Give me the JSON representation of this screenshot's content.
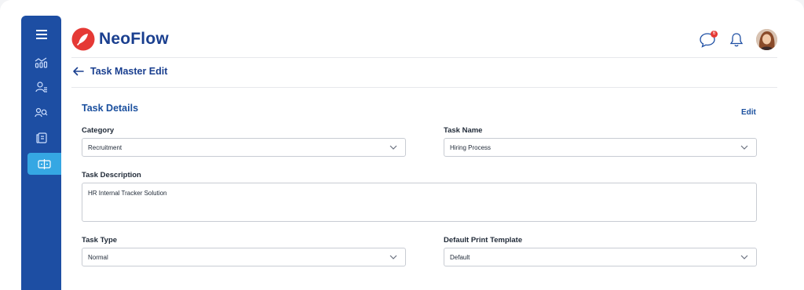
{
  "app": {
    "name": "NeoFlow"
  },
  "header": {
    "notifications_badge": "6"
  },
  "sidebar": {
    "items": [
      {
        "icon": "menu-icon"
      },
      {
        "icon": "analytics-icon"
      },
      {
        "icon": "user-list-icon"
      },
      {
        "icon": "people-search-icon"
      },
      {
        "icon": "documents-icon"
      },
      {
        "icon": "tasks-icon",
        "active": true
      }
    ]
  },
  "page": {
    "title": "Task Master Edit"
  },
  "section": {
    "title": "Task Details",
    "edit_label": "Edit"
  },
  "form": {
    "category": {
      "label": "Category",
      "value": "Recruitment"
    },
    "task_name": {
      "label": "Task Name",
      "value": "Hiring Process"
    },
    "task_description": {
      "label": "Task Description",
      "value": "HR Internal Tracker Solution"
    },
    "task_type": {
      "label": "Task Type",
      "value": "Normal"
    },
    "default_print_template": {
      "label": "Default Print Template",
      "value": "Default"
    }
  },
  "colors": {
    "sidebar": "#1d4ea3",
    "sidebar_active": "#35a7e3",
    "brand_text": "#1a3f8f",
    "logo_red": "#e53935"
  }
}
